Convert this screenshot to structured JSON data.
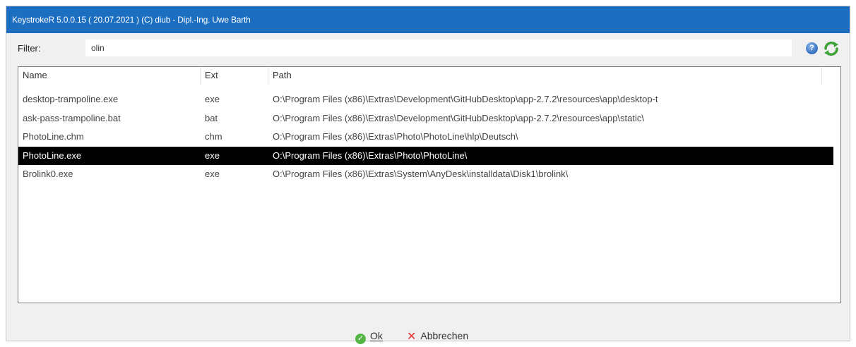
{
  "window": {
    "title": "KeystrokeR 5.0.0.15  ( 20.07.2021 ) (C)  diub - Dipl.-Ing. Uwe Barth"
  },
  "filter": {
    "label": "Filter:",
    "value": "olin"
  },
  "icons": {
    "help": "help-icon",
    "refresh": "refresh-icon",
    "ok": "check-icon",
    "cancel": "x-icon"
  },
  "list": {
    "columns": [
      "Name",
      "Ext",
      "Path"
    ],
    "rows": [
      {
        "name": "desktop-trampoline.exe",
        "ext": "exe",
        "path": "O:\\Program  Files  (x86)\\Extras\\Development\\GitHubDesktop\\app-2.7.2\\resources\\app\\desktop-t"
      },
      {
        "name": "ask-pass-trampoline.bat",
        "ext": "bat",
        "path": "O:\\Program  Files  (x86)\\Extras\\Development\\GitHubDesktop\\app-2.7.2\\resources\\app\\static\\"
      },
      {
        "name": "PhotoLine.chm",
        "ext": "chm",
        "path": "O:\\Program  Files  (x86)\\Extras\\Photo\\PhotoLine\\hlp\\Deutsch\\"
      },
      {
        "name": "PhotoLine.exe",
        "ext": "exe",
        "path": "O:\\Program  Files  (x86)\\Extras\\Photo\\PhotoLine\\"
      },
      {
        "name": "Brolink0.exe",
        "ext": "exe",
        "path": "O:\\Program  Files  (x86)\\Extras\\System\\AnyDesk\\installdata\\Disk1\\brolink\\"
      }
    ],
    "selected_index": 3
  },
  "buttons": {
    "ok_label": "Ok",
    "cancel_label": "Abbrechen"
  },
  "colors": {
    "titlebar": "#1c6ec0",
    "selection": "#000000",
    "ok": "#55b545",
    "cancel": "#e0312a"
  }
}
